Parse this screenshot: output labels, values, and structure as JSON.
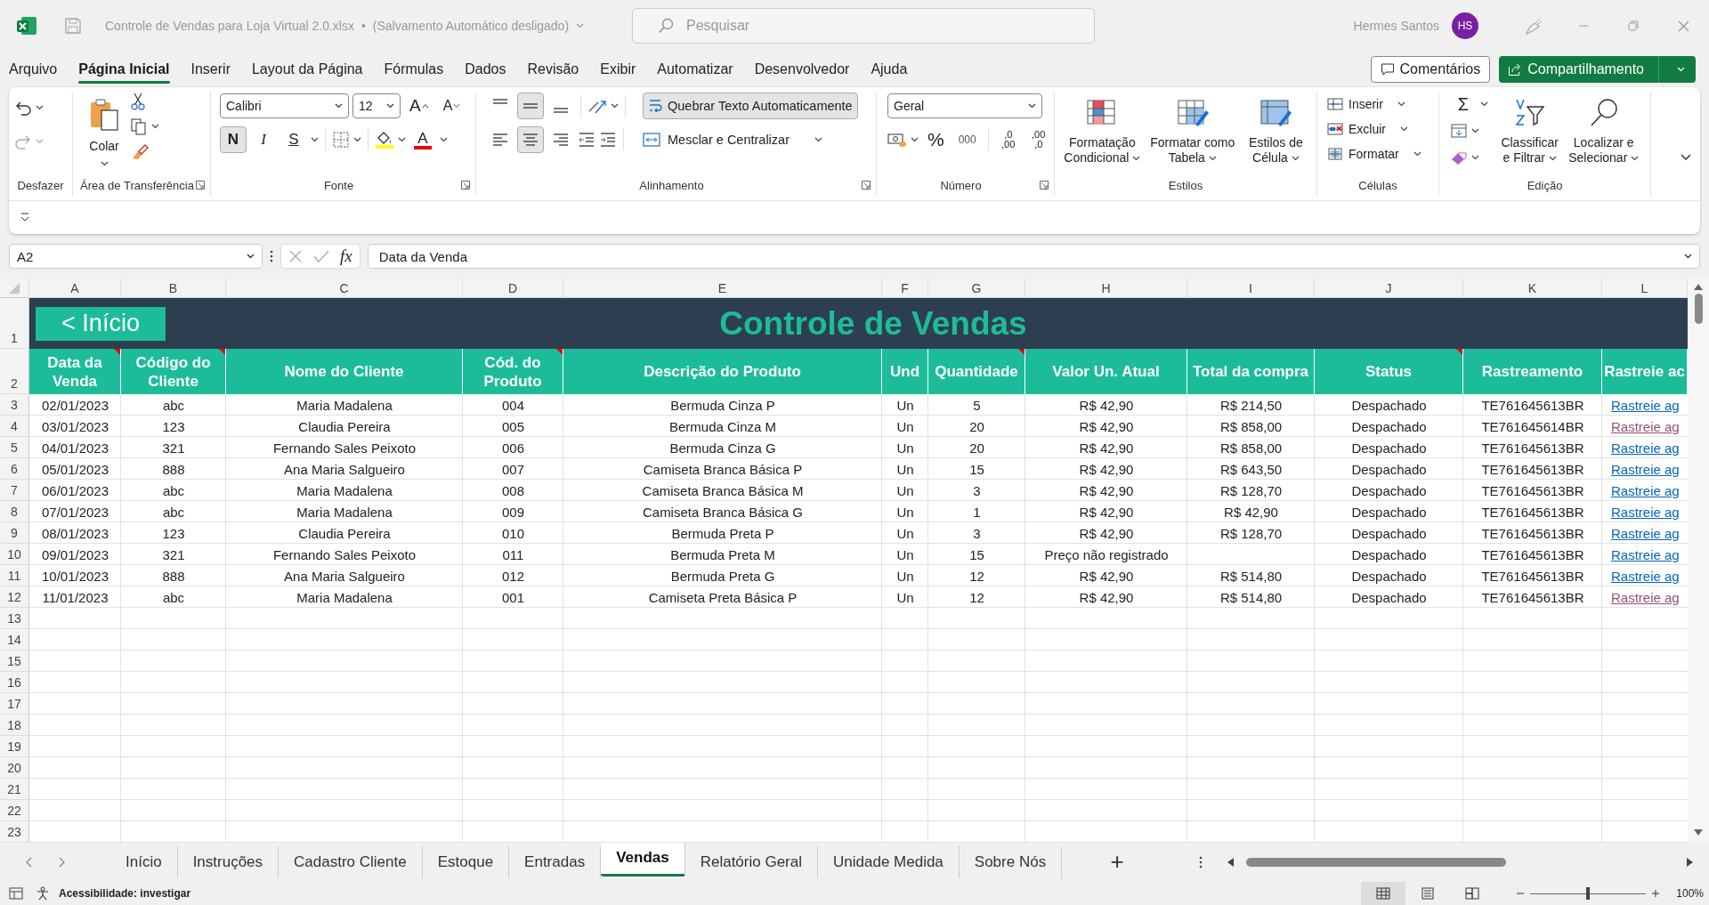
{
  "title_bar": {
    "file_name": "Controle de Vendas para Loja Virtual 2.0.xlsx",
    "separator": "•",
    "autosave": "(Salvamento Automático desligado)",
    "search_placeholder": "Pesquisar",
    "user_name": "Hermes Santos",
    "user_initials": "HS"
  },
  "menu_tabs": [
    {
      "label": "Arquivo",
      "selected": false
    },
    {
      "label": "Página Inicial",
      "selected": true
    },
    {
      "label": "Inserir",
      "selected": false
    },
    {
      "label": "Layout da Página",
      "selected": false
    },
    {
      "label": "Fórmulas",
      "selected": false
    },
    {
      "label": "Dados",
      "selected": false
    },
    {
      "label": "Revisão",
      "selected": false
    },
    {
      "label": "Exibir",
      "selected": false
    },
    {
      "label": "Automatizar",
      "selected": false
    },
    {
      "label": "Desenvolvedor",
      "selected": false
    },
    {
      "label": "Ajuda",
      "selected": false
    }
  ],
  "comments_button": "Comentários",
  "share_button": "Compartilhamento",
  "ribbon": {
    "undo": {
      "label": "Desfazer"
    },
    "clipboard": {
      "paste": "Colar",
      "label": "Área de Transferência"
    },
    "font": {
      "name": "Calibri",
      "size": "12",
      "grow": "A",
      "shrink": "A",
      "bold": {
        "text": "N",
        "on": true
      },
      "italic": {
        "text": "I",
        "on": false
      },
      "underline": {
        "text": "S",
        "on": false
      },
      "font_color": "A",
      "label": "Fonte"
    },
    "alignment": {
      "vertical": [
        {
          "on": false
        },
        {
          "on": true
        },
        {
          "on": false
        }
      ],
      "horizontal": [
        {
          "on": false
        },
        {
          "on": true
        },
        {
          "on": false
        }
      ],
      "wrap_text": {
        "text": "Quebrar Texto Automaticamente",
        "on": true
      },
      "merge": "Mesclar e Centralizar",
      "label": "Alinhamento"
    },
    "number": {
      "format": "Geral",
      "percent": "%",
      "thousands": "000",
      "increase_decimal": [
        ",0",
        ",00"
      ],
      "decrease_decimal": [
        ",00",
        ",0"
      ],
      "label": "Número"
    },
    "styles": {
      "items": [
        "Formatação Condicional",
        "Formatar como Tabela",
        "Estilos de Célula"
      ],
      "label": "Estilos"
    },
    "cells": {
      "items": [
        "Inserir",
        "Excluir",
        "Formatar"
      ],
      "label": "Células"
    },
    "editing": {
      "sum": "Σ",
      "items": [
        "Classificar e Filtrar",
        "Localizar e Selecionar"
      ],
      "label": "Edição"
    }
  },
  "formula_bar": {
    "name_box": "A2",
    "fx": "fx",
    "formula": "Data da Venda"
  },
  "columns": [
    "A",
    "B",
    "C",
    "D",
    "E",
    "F",
    "G",
    "H",
    "I",
    "J",
    "K",
    "L"
  ],
  "sheet": {
    "title_row_number": "1",
    "header_row_number": "2",
    "back_button": "< Início",
    "title": "Controle de Vendas",
    "headers": [
      {
        "text": "Data da Venda",
        "has_comment": true
      },
      {
        "text": "Código do Cliente",
        "has_comment": true
      },
      {
        "text": "Nome do Cliente",
        "has_comment": false
      },
      {
        "text": "Cód. do Produto",
        "has_comment": true
      },
      {
        "text": "Descrição do Produto",
        "has_comment": false
      },
      {
        "text": "Und",
        "has_comment": false
      },
      {
        "text": "Quantidade",
        "has_comment": true
      },
      {
        "text": "Valor Un. Atual",
        "has_comment": false
      },
      {
        "text": "Total da compra",
        "has_comment": false
      },
      {
        "text": "Status",
        "has_comment": true
      },
      {
        "text": "Rastreamento",
        "has_comment": false
      },
      {
        "text": "Rastreie ac",
        "has_comment": false
      }
    ],
    "rows": [
      {
        "number": "3",
        "cells": [
          "02/01/2023",
          "abc",
          "Maria Madalena",
          "004",
          "Bermuda Cinza P",
          "Un",
          "5",
          "R$ 42,90",
          "R$ 214,50",
          "Despachado",
          "TE761645613BR"
        ],
        "tracking_link": {
          "text": "Rastreie ag",
          "visited": false
        }
      },
      {
        "number": "4",
        "cells": [
          "03/01/2023",
          "123",
          "Claudia Pereira",
          "005",
          "Bermuda Cinza M",
          "Un",
          "20",
          "R$ 42,90",
          "R$ 858,00",
          "Despachado",
          "TE761645614BR"
        ],
        "tracking_link": {
          "text": "Rastreie ag",
          "visited": true
        }
      },
      {
        "number": "5",
        "cells": [
          "04/01/2023",
          "321",
          "Fernando Sales Peixoto",
          "006",
          "Bermuda Cinza G",
          "Un",
          "20",
          "R$ 42,90",
          "R$ 858,00",
          "Despachado",
          "TE761645613BR"
        ],
        "tracking_link": {
          "text": "Rastreie ag",
          "visited": false
        }
      },
      {
        "number": "6",
        "cells": [
          "05/01/2023",
          "888",
          "Ana Maria Salgueiro",
          "007",
          "Camiseta Branca Básica P",
          "Un",
          "15",
          "R$ 42,90",
          "R$ 643,50",
          "Despachado",
          "TE761645613BR"
        ],
        "tracking_link": {
          "text": "Rastreie ag",
          "visited": false
        }
      },
      {
        "number": "7",
        "cells": [
          "06/01/2023",
          "abc",
          "Maria Madalena",
          "008",
          "Camiseta Branca Básica M",
          "Un",
          "3",
          "R$ 42,90",
          "R$ 128,70",
          "Despachado",
          "TE761645613BR"
        ],
        "tracking_link": {
          "text": "Rastreie ag",
          "visited": false
        }
      },
      {
        "number": "8",
        "cells": [
          "07/01/2023",
          "abc",
          "Maria Madalena",
          "009",
          "Camiseta Branca Básica G",
          "Un",
          "1",
          "R$ 42,90",
          "R$ 42,90",
          "Despachado",
          "TE761645613BR"
        ],
        "tracking_link": {
          "text": "Rastreie ag",
          "visited": false
        }
      },
      {
        "number": "9",
        "cells": [
          "08/01/2023",
          "123",
          "Claudia Pereira",
          "010",
          "Bermuda Preta P",
          "Un",
          "3",
          "R$ 42,90",
          "R$ 128,70",
          "Despachado",
          "TE761645613BR"
        ],
        "tracking_link": {
          "text": "Rastreie ag",
          "visited": false
        }
      },
      {
        "number": "10",
        "cells": [
          "09/01/2023",
          "321",
          "Fernando Sales Peixoto",
          "011",
          "Bermuda Preta M",
          "Un",
          "15",
          "Preço não registrado",
          "",
          "Despachado",
          "TE761645613BR"
        ],
        "tracking_link": {
          "text": "Rastreie ag",
          "visited": false
        }
      },
      {
        "number": "11",
        "cells": [
          "10/01/2023",
          "888",
          "Ana Maria Salgueiro",
          "012",
          "Bermuda Preta G",
          "Un",
          "12",
          "R$ 42,90",
          "R$ 514,80",
          "Despachado",
          "TE761645613BR"
        ],
        "tracking_link": {
          "text": "Rastreie ag",
          "visited": false
        }
      },
      {
        "number": "12",
        "cells": [
          "11/01/2023",
          "abc",
          "Maria Madalena",
          "001",
          "Camiseta Preta Básica P",
          "Un",
          "12",
          "R$ 42,90",
          "R$ 514,80",
          "Despachado",
          "TE761645613BR"
        ],
        "tracking_link": {
          "text": "Rastreie ag",
          "visited": true
        }
      }
    ],
    "empty_rows": [
      "13",
      "14",
      "15",
      "16",
      "17",
      "18",
      "19",
      "20",
      "21",
      "22",
      "23"
    ]
  },
  "sheet_tabs": [
    {
      "label": "Início",
      "selected": false
    },
    {
      "label": "Instruções",
      "selected": false
    },
    {
      "label": "Cadastro Cliente",
      "selected": false
    },
    {
      "label": "Estoque",
      "selected": false
    },
    {
      "label": "Entradas",
      "selected": false
    },
    {
      "label": "Vendas",
      "selected": true
    },
    {
      "label": "Relatório Geral",
      "selected": false
    },
    {
      "label": "Unidade Medida",
      "selected": false
    },
    {
      "label": "Sobre Nós",
      "selected": false
    }
  ],
  "add_sheet": "+",
  "status_bar": {
    "accessibility": "Acessibilidade: investigar",
    "zoom_slider": {
      "level": 0.5
    },
    "zoom": "100%"
  }
}
